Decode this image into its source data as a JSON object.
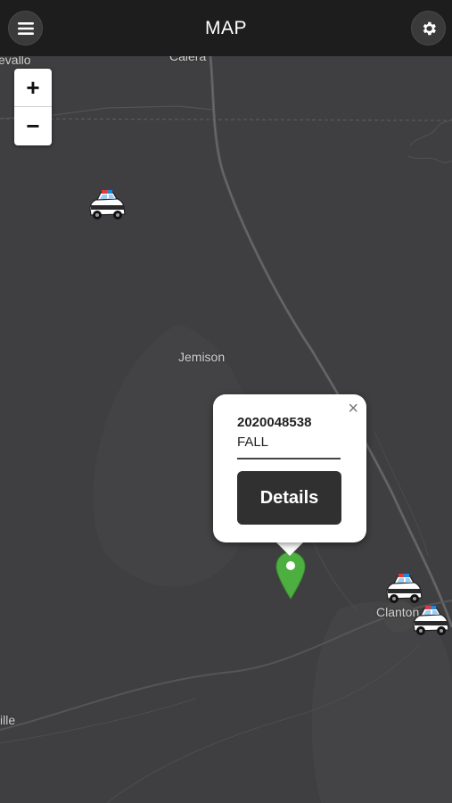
{
  "header": {
    "title": "MAP",
    "menu_icon": "hamburger-menu-icon",
    "settings_icon": "gear-icon"
  },
  "map": {
    "zoom_in_label": "+",
    "zoom_out_label": "−",
    "place_labels": {
      "top_left": "evallo",
      "top_center": "Calera",
      "center": "Jemison",
      "right": "Clanton",
      "bottom_left": "ille"
    },
    "marker_color": "#4caf3f",
    "background_color": "#3f3f41"
  },
  "popup": {
    "incident_number": "2020048538",
    "incident_type": "FALL",
    "close_label": "×",
    "details_label": "Details"
  }
}
